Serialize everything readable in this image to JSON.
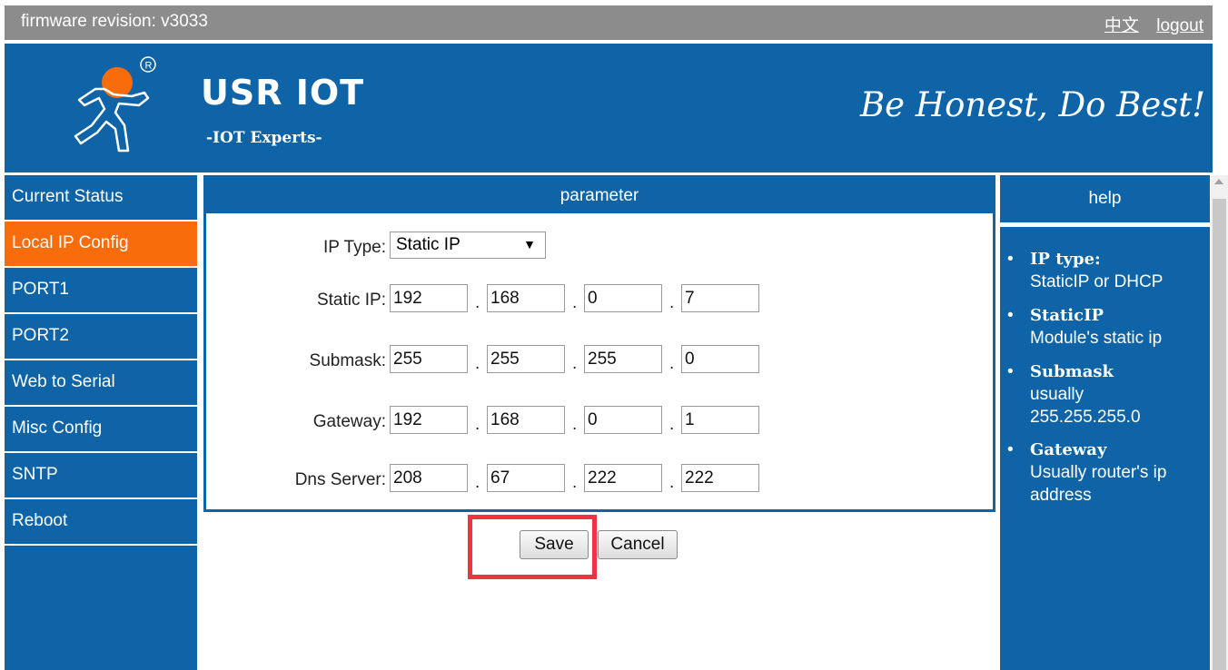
{
  "topbar": {
    "firmware": "firmware revision: v3033",
    "lang_link": "中文",
    "logout_link": "logout"
  },
  "header": {
    "brand": "USR IOT",
    "tagline": "-IOT Experts-",
    "motto": "Be Honest, Do Best!",
    "logo_icon": "usr-person-logo-icon",
    "colors": {
      "header_bg": "#0f64a7",
      "accent": "#f86c0b",
      "highlight": "#ee3341"
    }
  },
  "sidebar": {
    "items": [
      {
        "label": "Current Status"
      },
      {
        "label": "Local IP Config",
        "active": true
      },
      {
        "label": "PORT1"
      },
      {
        "label": "PORT2"
      },
      {
        "label": "Web to Serial"
      },
      {
        "label": "Misc Config"
      },
      {
        "label": "SNTP"
      },
      {
        "label": "Reboot"
      }
    ]
  },
  "parameter": {
    "title": "parameter",
    "ip_type": {
      "label": "IP Type:",
      "value": "Static IP"
    },
    "static_ip": {
      "label": "Static IP:",
      "octets": [
        "192",
        "168",
        "0",
        "7"
      ]
    },
    "submask": {
      "label": "Submask:",
      "octets": [
        "255",
        "255",
        "255",
        "0"
      ]
    },
    "gateway": {
      "label": "Gateway:",
      "octets": [
        "192",
        "168",
        "0",
        "1"
      ]
    },
    "dns": {
      "label": "Dns Server:",
      "octets": [
        "208",
        "67",
        "222",
        "222"
      ]
    },
    "dot": "."
  },
  "buttons": {
    "save": "Save",
    "cancel": "Cancel"
  },
  "help": {
    "title": "help",
    "bullet": "•",
    "items": [
      {
        "title": "IP type:",
        "desc": "StaticIP or DHCP"
      },
      {
        "title": "StaticIP",
        "desc": "Module's static ip"
      },
      {
        "title": "Submask",
        "desc": "usually 255.255.255.0"
      },
      {
        "title": "Gateway",
        "desc": "Usually router's ip address"
      }
    ]
  }
}
